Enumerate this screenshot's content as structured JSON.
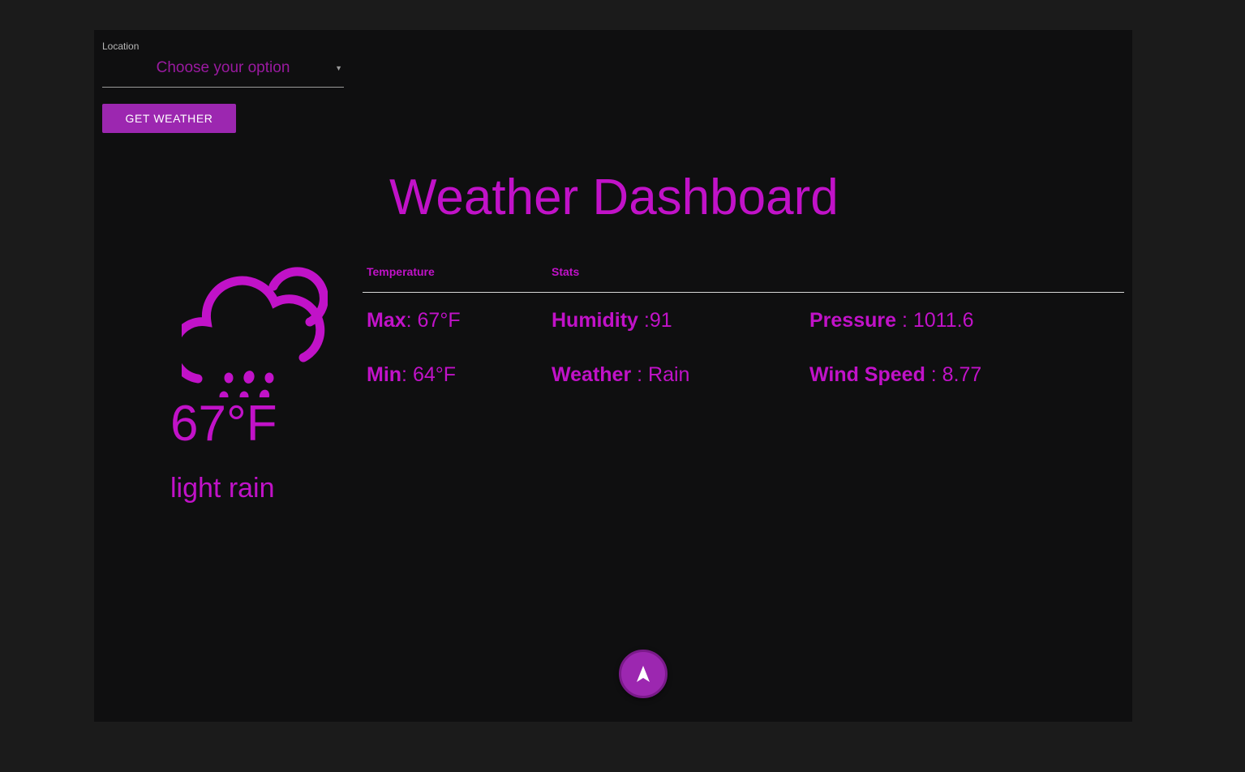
{
  "colors": {
    "accent": "#c112c8",
    "button": "#9c27b0",
    "background": "#1b1b1b",
    "card": "#0f0f10"
  },
  "location": {
    "label": "Location",
    "selected": "Choose your option"
  },
  "get_weather_button": "GET WEATHER",
  "title": "Weather Dashboard",
  "current": {
    "icon": "rain-cloud-sun-icon",
    "temperature": "67°F",
    "description": "light rain"
  },
  "table": {
    "headers": [
      "Temperature",
      "Stats"
    ],
    "max_label": "Max",
    "max_value": ": 67°F",
    "min_label": "Min",
    "min_value": ": 64°F",
    "humidity_label": "Humidity",
    "humidity_value": " :91",
    "weather_label": "Weather",
    "weather_value": " : Rain",
    "pressure_label": "Pressure",
    "pressure_value": " : 1011.6",
    "wind_label": "Wind Speed",
    "wind_value": " : 8.77"
  },
  "fab_icon": "navigation-arrow-icon"
}
